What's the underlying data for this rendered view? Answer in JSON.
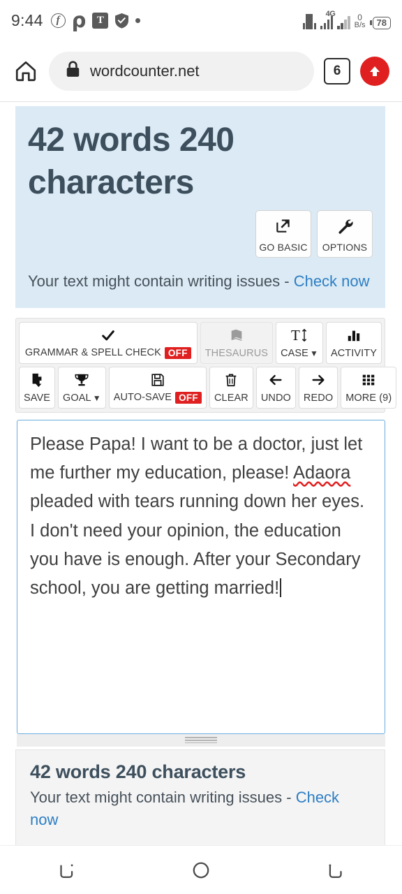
{
  "statusbar": {
    "time": "9:44",
    "left_icons": [
      "facebook-icon",
      "opera-icon",
      "t-app-icon",
      "shield-icon",
      "dot-icon"
    ],
    "network_type": "4G",
    "data_speed_value": "0",
    "data_speed_unit": "B/s",
    "battery": "78"
  },
  "browser": {
    "home_icon": "home-icon",
    "lock_icon": "lock-icon",
    "url": "wordcounter.net",
    "tab_count": "6",
    "update_icon": "arrow-up-circle-icon"
  },
  "counter_panel": {
    "title": "42 words 240 characters",
    "buttons": [
      {
        "label": "GO BASIC",
        "icon": "external-link-icon"
      },
      {
        "label": "OPTIONS",
        "icon": "wrench-icon"
      }
    ],
    "notice_text": "Your text might contain writing issues - ",
    "notice_link": "Check now"
  },
  "toolbar": {
    "row1": [
      {
        "label": "GRAMMAR & SPELL CHECK",
        "badge": "OFF",
        "icon": "check-icon",
        "disabled": false
      },
      {
        "label": "THESAURUS",
        "icon": "book-icon",
        "disabled": true
      },
      {
        "label": "CASE",
        "caret": "▼",
        "icon": "text-size-icon",
        "disabled": false
      },
      {
        "label": "ACTIVITY",
        "icon": "bar-chart-icon",
        "disabled": false
      }
    ],
    "row2": [
      {
        "label": "SAVE",
        "icon": "file-download-icon"
      },
      {
        "label": "GOAL",
        "caret": "▼",
        "icon": "trophy-icon"
      },
      {
        "label": "AUTO-SAVE",
        "badge": "OFF",
        "icon": "floppy-disk-icon"
      },
      {
        "label": "CLEAR",
        "icon": "trash-icon"
      },
      {
        "label": "UNDO",
        "icon": "arrow-left-icon"
      },
      {
        "label": "REDO",
        "icon": "arrow-right-icon"
      },
      {
        "label": "MORE (9)",
        "icon": "grid-icon"
      }
    ]
  },
  "editor": {
    "text_before_misspelling": "Please Papa! I want to be a doctor, just let me further my education, please! ",
    "misspelled_word": "Adaora",
    "text_after_misspelling": " pleaded with tears running down her eyes. I don't need your opinion, the education you have is enough. After your Secondary school, you are getting married!"
  },
  "footer": {
    "title": "42 words 240 characters",
    "notice_text": "Your text might contain writing issues - ",
    "notice_link": "Check now"
  },
  "navbar": {
    "recents_icon": "recents-icon",
    "home_icon": "home-circle-icon",
    "back_icon": "back-icon"
  },
  "colors": {
    "panel_blue": "#dbeaf4",
    "heading": "#3d4f5d",
    "link": "#2d7ec4",
    "accent_red": "#e02020",
    "editor_border": "#6aaee0"
  }
}
